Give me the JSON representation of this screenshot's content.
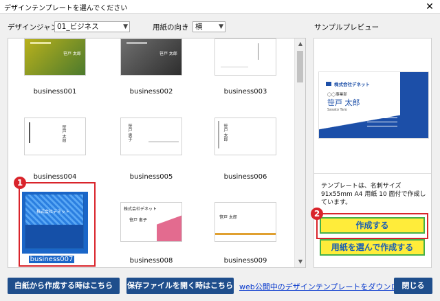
{
  "window": {
    "title": "デザインテンプレートを選んでください",
    "close_glyph": "✕"
  },
  "filters": {
    "genre_label": "デザインジャンル",
    "genre_value": "01_ビジネス",
    "orientation_label": "用紙の向き",
    "orientation_value": "横"
  },
  "templates": [
    {
      "name": "business001",
      "card_lines": [
        "笹戸 太郎"
      ]
    },
    {
      "name": "business002",
      "card_lines": [
        "笹戸 太郎"
      ]
    },
    {
      "name": "business003",
      "card_lines": []
    },
    {
      "name": "business004",
      "card_lines": [
        "笹戸 太郎"
      ]
    },
    {
      "name": "business005",
      "card_lines": [
        "笹戸 恵子"
      ]
    },
    {
      "name": "business006",
      "card_lines": [
        "笹戸 太郎"
      ]
    },
    {
      "name": "business007",
      "card_lines": [
        "株式会社デネット"
      ]
    },
    {
      "name": "business008",
      "card_lines": [
        "株式会社デネット",
        "笹戸 恵子"
      ]
    },
    {
      "name": "business009",
      "card_lines": [
        "笹戸 太郎"
      ]
    }
  ],
  "preview": {
    "label": "サンプルプレビュー",
    "company": "株式会社デネット",
    "department": "◯◯事業部",
    "person_name": "笹戸 太郎",
    "person_romaji": "Sasato Taro",
    "description": "テンプレートは、名刺サイズ 91x55mm A4 用紙 10 面付で作成しています。"
  },
  "buttons": {
    "create": "作成する",
    "choose_paper": "用紙を選んで作成する",
    "blank": "白紙から作成する時はこちら",
    "open_file": "保存ファイルを開く時はこちら",
    "download_link": "web公開中のデザインテンプレートをダウンロードする",
    "close": "閉じる"
  },
  "badges": {
    "step1": "1",
    "step2": "2"
  },
  "colors": {
    "accent_blue": "#1f4e8c",
    "highlight_yellow": "#ffec3a",
    "callout_red": "#d9242b",
    "border_green": "#45b04a"
  }
}
